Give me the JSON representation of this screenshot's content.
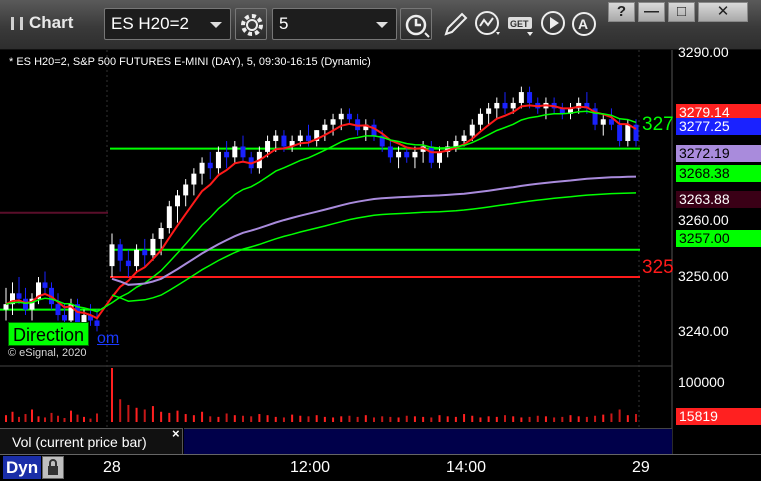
{
  "window": {
    "title": "Chart",
    "symbol": "ES H20=2",
    "interval": "5",
    "buttons": [
      "?",
      "—",
      "□",
      "✕"
    ]
  },
  "chart": {
    "study_label": "* ES H20=2, S&P 500 FUTURES E-MINI (DAY), 5, 09:30-16:15 (Dynamic)",
    "copyright": "© eSignal, 2020",
    "direction_badge": "Direction",
    "direction_link": "om",
    "axis_ticks": [
      "3290.00",
      "3260.00",
      "3250.00",
      "3240.00"
    ],
    "price_tags": [
      {
        "value": "3279.14",
        "bg": "#ff2020",
        "fg": "#ffffff"
      },
      {
        "value": "3277.25",
        "bg": "#1a22ff",
        "fg": "#ffffff"
      },
      {
        "value": "3272.19",
        "bg": "#a98bdc",
        "fg": "#000000"
      },
      {
        "value": "3268.38",
        "bg": "#00ff00",
        "fg": "#000000"
      },
      {
        "value": "3263.88",
        "bg": "#3a0016",
        "fg": "#ffffff"
      },
      {
        "value": "3257.00",
        "bg": "#00ff00",
        "fg": "#000000"
      }
    ],
    "line_labels": {
      "green": "327",
      "red": "325"
    },
    "colors": {
      "up": "#ffffff",
      "down": "#1a22ff",
      "green": "#00ff00",
      "red": "#ff1a1a",
      "purple": "#a98bdc",
      "maroon": "#5a0e2a"
    }
  },
  "chart_data": {
    "type": "line",
    "price_min": 3236,
    "price_max": 3293,
    "bars": [
      [
        3246,
        3250,
        3244,
        3247
      ],
      [
        3247,
        3251,
        3245,
        3249
      ],
      [
        3249,
        3252,
        3247,
        3248
      ],
      [
        3248,
        3250,
        3245,
        3246
      ],
      [
        3246,
        3249,
        3244,
        3248
      ],
      [
        3248,
        3252,
        3247,
        3251
      ],
      [
        3251,
        3253,
        3249,
        3250
      ],
      [
        3250,
        3251,
        3246,
        3247
      ],
      [
        3247,
        3249,
        3244,
        3245
      ],
      [
        3245,
        3247,
        3242,
        3244
      ],
      [
        3244,
        3248,
        3243,
        3247
      ],
      [
        3247,
        3248,
        3242,
        3243
      ],
      [
        3243,
        3246,
        3241,
        3245
      ],
      [
        3245,
        3247,
        3243,
        3244
      ],
      [
        3244,
        3246,
        3242,
        3243
      ],
      [
        3254,
        3260,
        3252,
        3258
      ],
      [
        3258,
        3259,
        3253,
        3255
      ],
      [
        3255,
        3257,
        3252,
        3254
      ],
      [
        3254,
        3258,
        3253,
        3257
      ],
      [
        3257,
        3259,
        3254,
        3256
      ],
      [
        3256,
        3260,
        3255,
        3259
      ],
      [
        3259,
        3262,
        3256,
        3261
      ],
      [
        3261,
        3266,
        3260,
        3265
      ],
      [
        3265,
        3268,
        3262,
        3267
      ],
      [
        3267,
        3270,
        3265,
        3269
      ],
      [
        3269,
        3272,
        3267,
        3271
      ],
      [
        3271,
        3274,
        3269,
        3273
      ],
      [
        3273,
        3275,
        3270,
        3272
      ],
      [
        3272,
        3276,
        3271,
        3275
      ],
      [
        3275,
        3277,
        3272,
        3274
      ],
      [
        3274,
        3277,
        3273,
        3276
      ],
      [
        3276,
        3278,
        3273,
        3274
      ],
      [
        3274,
        3275,
        3271,
        3272
      ],
      [
        3272,
        3276,
        3271,
        3275
      ],
      [
        3275,
        3278,
        3274,
        3277
      ],
      [
        3277,
        3279,
        3275,
        3278
      ],
      [
        3278,
        3279,
        3275,
        3276
      ],
      [
        3276,
        3278,
        3275,
        3277
      ],
      [
        3277,
        3279,
        3276,
        3278
      ],
      [
        3278,
        3280,
        3276,
        3277
      ],
      [
        3277,
        3279,
        3276,
        3279
      ],
      [
        3279,
        3281,
        3277,
        3280
      ],
      [
        3280,
        3282,
        3278,
        3281
      ],
      [
        3281,
        3283,
        3279,
        3282
      ],
      [
        3282,
        3283,
        3280,
        3281
      ],
      [
        3281,
        3282,
        3278,
        3279
      ],
      [
        3279,
        3281,
        3277,
        3280
      ],
      [
        3280,
        3281,
        3277,
        3278
      ],
      [
        3278,
        3279,
        3275,
        3276
      ],
      [
        3276,
        3277,
        3273,
        3274
      ],
      [
        3274,
        3276,
        3272,
        3275
      ],
      [
        3275,
        3276,
        3273,
        3274
      ],
      [
        3274,
        3276,
        3272,
        3275
      ],
      [
        3275,
        3277,
        3273,
        3276
      ],
      [
        3276,
        3277,
        3272,
        3273
      ],
      [
        3273,
        3276,
        3272,
        3275
      ],
      [
        3275,
        3277,
        3274,
        3276
      ],
      [
        3276,
        3278,
        3275,
        3277
      ],
      [
        3277,
        3279,
        3276,
        3278
      ],
      [
        3278,
        3281,
        3277,
        3280
      ],
      [
        3280,
        3283,
        3279,
        3282
      ],
      [
        3282,
        3284,
        3280,
        3283
      ],
      [
        3283,
        3285,
        3281,
        3284
      ],
      [
        3284,
        3286,
        3282,
        3283
      ],
      [
        3283,
        3285,
        3282,
        3284
      ],
      [
        3284,
        3287,
        3283,
        3286
      ],
      [
        3286,
        3287,
        3283,
        3284
      ],
      [
        3284,
        3285,
        3282,
        3283
      ],
      [
        3283,
        3285,
        3281,
        3284
      ],
      [
        3284,
        3285,
        3282,
        3283
      ],
      [
        3283,
        3284,
        3281,
        3282
      ],
      [
        3282,
        3284,
        3281,
        3283
      ],
      [
        3283,
        3285,
        3282,
        3284
      ],
      [
        3284,
        3286,
        3282,
        3283
      ],
      [
        3283,
        3284,
        3279,
        3280
      ],
      [
        3280,
        3282,
        3278,
        3281
      ],
      [
        3281,
        3283,
        3279,
        3280
      ],
      [
        3280,
        3281,
        3276,
        3277
      ],
      [
        3277,
        3281,
        3276,
        3280
      ],
      [
        3280,
        3281,
        3276,
        3277
      ]
    ],
    "vwap": [
      3249,
      3249,
      3249,
      3249,
      3248,
      3248,
      3248,
      3248,
      3247,
      3247,
      3247,
      3247,
      3246,
      3246,
      3245,
      3253,
      3254,
      3255,
      3256,
      3257,
      3258,
      3259,
      3260,
      3261,
      3262,
      3263,
      3263,
      3264,
      3264,
      3265
    ],
    "volume": [
      12,
      18,
      9,
      14,
      22,
      10,
      8,
      16,
      11,
      7,
      20,
      13,
      9,
      6,
      15,
      95,
      40,
      30,
      25,
      22,
      28,
      18,
      16,
      20,
      14,
      12,
      18,
      10,
      9,
      15,
      12,
      11,
      10,
      14,
      12,
      9,
      8,
      13,
      11,
      10,
      12,
      9,
      8,
      10,
      11,
      9,
      12,
      8,
      10,
      9,
      8,
      11,
      10,
      9,
      8,
      12,
      10,
      9,
      14,
      11,
      8,
      10,
      9,
      12,
      10,
      8,
      9,
      11,
      10,
      8,
      9,
      12,
      10,
      9,
      11,
      13,
      15,
      22,
      12,
      14
    ],
    "volume_ticks": [
      "100000",
      "15819"
    ],
    "x_ticks": [
      "28",
      "12:00",
      "14:00",
      "29"
    ]
  },
  "bottom": {
    "vol_label": "Vol (current price bar)",
    "vol_close": "×",
    "dyn_label": "Dyn"
  }
}
